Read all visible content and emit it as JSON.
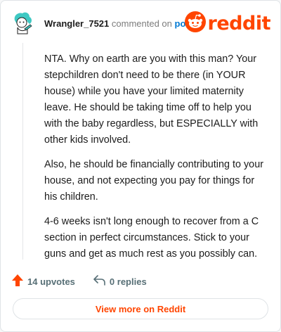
{
  "comment": {
    "username": "Wrangler_7521",
    "action_text": "commented on",
    "post_link": "post",
    "paragraphs": [
      "NTA. Why on earth are you with this man? Your stepchildren don't need to be there (in YOUR house) while you have your limited maternity leave. He should be taking time off to help you with the baby regardless, but ESPECIALLY with other kids involved.",
      "Also, he should be financially contributing to your house, and not expecting you pay for things for his children.",
      "4-6 weeks isn't long enough to recover from a C section in perfect circumstances. Stick to your guns and get as much rest as you possibly can."
    ]
  },
  "brand": {
    "logo_text": "reddit",
    "color": "#ff4500"
  },
  "actions": {
    "upvotes": "14 upvotes",
    "replies": "0 replies"
  },
  "footer": {
    "view_more_label": "View more on Reddit"
  },
  "icons": {
    "avatar": "avatar-icon",
    "logo": "reddit-alien-icon",
    "upvote": "upvote-arrow-icon",
    "reply": "reply-arrow-icon"
  }
}
